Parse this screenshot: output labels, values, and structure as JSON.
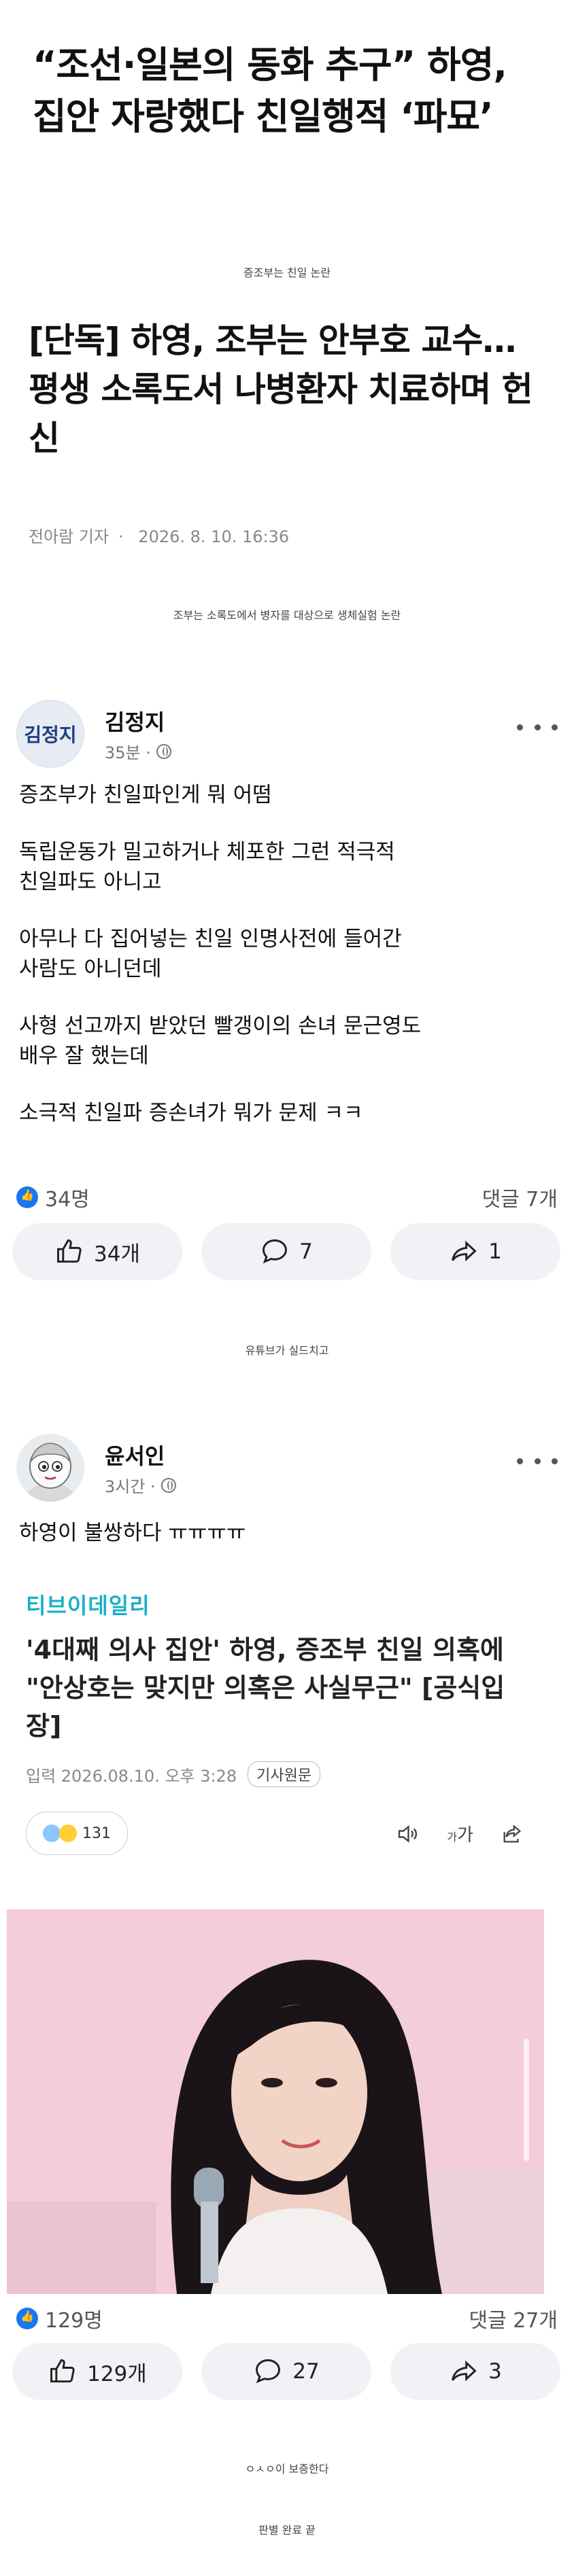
{
  "headline1": "“조선·일본의 동화 추구” 하영, 집안 자랑했다 친일행적 ‘파묘’",
  "note1": "증조부는 친일 논란",
  "headline2": "[단독] 하영, 조부는 안부호 교수… 평생 소록도서 나병환자 치료하며 헌신",
  "byline": {
    "author": "전아람 기자",
    "sep": "·",
    "date": "2026. 8. 10. 16:36"
  },
  "note2": "조부는 소록도에서 병자를 대상으로 생체실험 논란",
  "post1": {
    "avatar_text": "김정지",
    "name": "김정지",
    "time": "35분 ·",
    "paragraphs": [
      "증조부가 친일파인게 뭐 어떰",
      "독립운동가 밀고하거나 체포한 그런 적극적\n친일파도 아니고",
      "아무나 다 집어넣는 친일 인명사전에 들어간\n사람도 아니던데",
      "사형 선고까지 받았던 빨갱이의 손녀 문근영도\n배우 잘 했는데",
      "소극적 친일파 증손녀가 뭐가 문제 ㅋㅋ"
    ],
    "reactions": "34명",
    "comments": "댓글 7개",
    "like_btn": "34개",
    "comment_btn": "7",
    "share_btn": "1"
  },
  "note3": "유튜브가 실드치고",
  "post2": {
    "name": "윤서인",
    "time": "3시간 ·",
    "text": "하영이 불쌍하다 ㅠㅠㅠㅠ",
    "article": {
      "brand": "티브이데일리",
      "title": "'4대째 의사 집안' 하영, 증조부 친일 의혹에 \"안상호는 맞지만 의혹은 사실무근\" [공식입장]",
      "date": "입력 2026.08.10. 오후 3:28",
      "badge": "기사원문",
      "reaction_count": "131",
      "font_label": "가"
    },
    "reactions": "129명",
    "comments": "댓글 27개",
    "like_btn": "129개",
    "comment_btn": "27",
    "share_btn": "3"
  },
  "note4": "ㅇㅅㅇ이 보증한다",
  "note5": "판별 완료 끝",
  "colors": {
    "like_blue": "#1877f2",
    "brand_teal": "#1bb0c7",
    "button_gray": "#f0f2f5"
  }
}
